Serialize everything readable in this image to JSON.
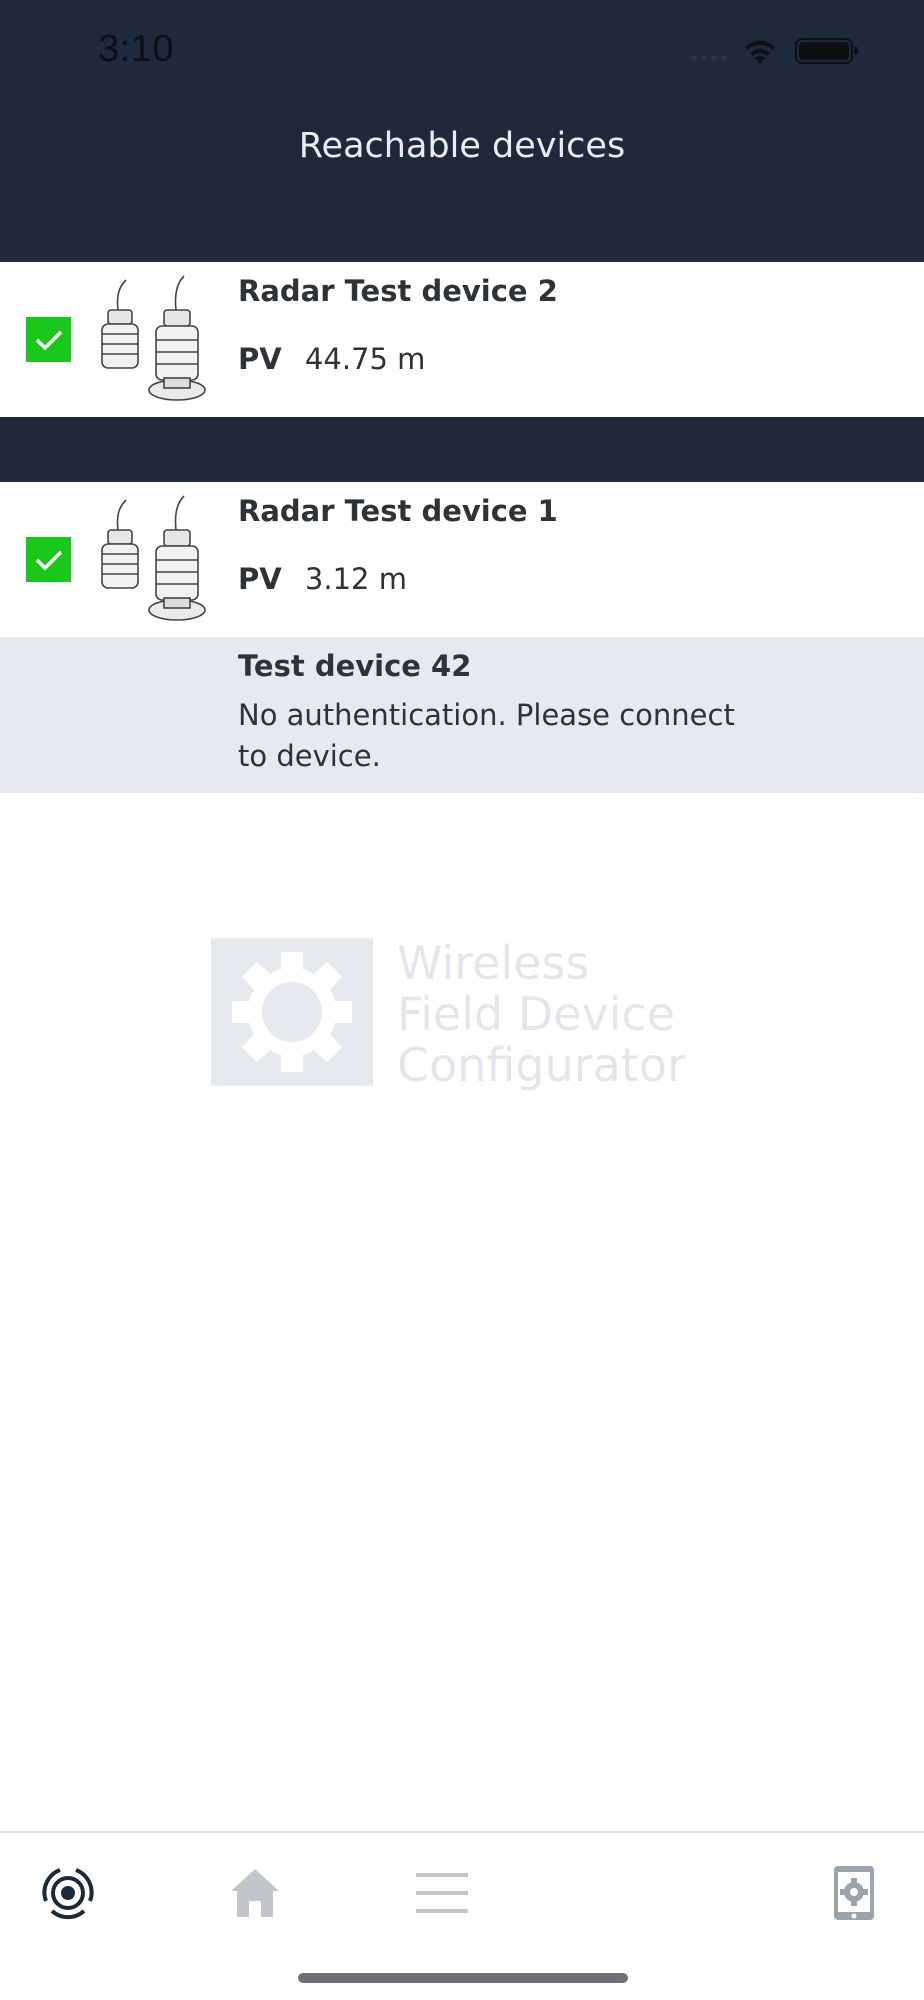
{
  "status_bar": {
    "time": "3:10",
    "icons": [
      "signal-dots-icon",
      "wifi-icon",
      "battery-icon"
    ]
  },
  "header": {
    "title": "Reachable devices"
  },
  "devices": [
    {
      "name": "Radar Test device 2",
      "pv_label": "PV",
      "pv_value": "44.75 m",
      "checked": true
    },
    {
      "name": "Radar Test device 1",
      "pv_label": "PV",
      "pv_value": "3.12 m",
      "checked": true
    },
    {
      "name": "Test device 42",
      "message": "No authentication. Please connect to device."
    }
  ],
  "watermark": {
    "line1": "Wireless",
    "line2": "Field Device",
    "line3": "Configurator"
  },
  "tabbar": {
    "tabs": [
      "devices-radar-icon",
      "home-icon",
      "menu-icon",
      "device-settings-icon"
    ],
    "active_tab": "devices-radar-icon"
  },
  "colors": {
    "header_bg": "#1c2a3b",
    "checkbox_green": "#19c81b",
    "disabled_row_bg": "#e6eaee",
    "active_tab": "#1c2a3b",
    "inactive_tab": "#c2c6ca"
  }
}
